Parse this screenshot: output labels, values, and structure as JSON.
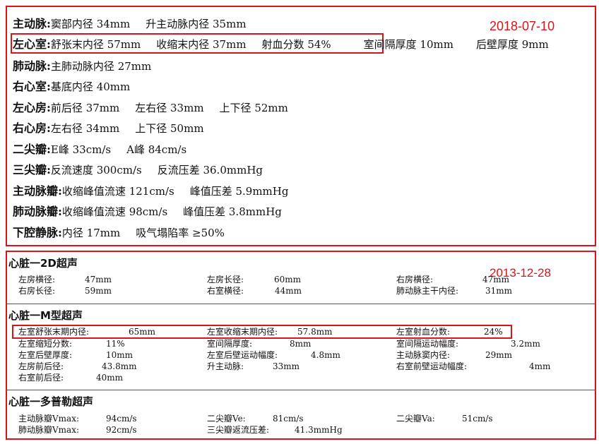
{
  "dates": {
    "recent": "2018-07-10",
    "older": "2013-12-28"
  },
  "report2018": [
    {
      "label": "主动脉:",
      "items": [
        "窦部内径 34mm",
        "升主动脉内径 35mm"
      ]
    },
    {
      "label": "左心室:",
      "items": [
        "舒张末内径 57mm",
        "收缩末内径 37mm",
        "射血分数 54%",
        "室间隔厚度 10mm",
        "后壁厚度 9mm"
      ]
    },
    {
      "label": "肺动脉:",
      "items": [
        "主肺动脉内径 27mm"
      ]
    },
    {
      "label": "右心室:",
      "items": [
        "基底内径 40mm"
      ]
    },
    {
      "label": "左心房:",
      "items": [
        "前后径 37mm",
        "左右径 33mm",
        "上下径 52mm"
      ]
    },
    {
      "label": "右心房:",
      "items": [
        "左右径 34mm",
        "上下径 50mm"
      ]
    },
    {
      "label": "二尖瓣:",
      "items": [
        "E峰 33cm/s",
        "A峰 84cm/s"
      ]
    },
    {
      "label": "三尖瓣:",
      "items": [
        "反流速度 300cm/s",
        "反流压差 36.0mmHg"
      ]
    },
    {
      "label": "主动脉瓣:",
      "items": [
        "收缩峰值流速 121cm/s",
        "峰值压差 5.9mmHg"
      ]
    },
    {
      "label": "肺动脉瓣:",
      "items": [
        "收缩峰值流速 98cm/s",
        "峰值压差 3.8mmHg"
      ]
    },
    {
      "label": "下腔静脉:",
      "items": [
        "内径 17mm",
        "吸气塌陷率 ≥50%"
      ]
    }
  ],
  "sections2013": {
    "s2d": {
      "title": "心脏一2D超声",
      "cells": [
        {
          "k": "左房横径:",
          "v": "47mm"
        },
        {
          "k": "左房长径:",
          "v": "60mm"
        },
        {
          "k": "右房横径:",
          "v": "47mm"
        },
        {
          "k": "右房长径:",
          "v": "59mm"
        },
        {
          "k": "右室横径:",
          "v": "44mm"
        },
        {
          "k": "肺动脉主干内径:",
          "v": "31mm"
        }
      ]
    },
    "sm": {
      "title": "心脏一M型超声",
      "cells": [
        {
          "k": "左室舒张末期内径:",
          "v": "65mm"
        },
        {
          "k": "左室收缩末期内径:",
          "v": "57.8mm"
        },
        {
          "k": "左室射血分数:",
          "v": "24%"
        },
        {
          "k": "左室缩短分数:",
          "v": "11%"
        },
        {
          "k": "室间隔厚度:",
          "v": "8mm"
        },
        {
          "k": "室间隔运动幅度:",
          "v": "3.2mm"
        },
        {
          "k": "左室后壁厚度:",
          "v": "10mm"
        },
        {
          "k": "左室后壁运动幅度:",
          "v": "4.8mm"
        },
        {
          "k": "主动脉窦内径:",
          "v": "29mm"
        },
        {
          "k": "左房前后径:",
          "v": "43.8mm"
        },
        {
          "k": "升主动脉:",
          "v": "33mm"
        },
        {
          "k": "右室前壁运动幅度:",
          "v": "4mm"
        },
        {
          "k": "右室前后径:",
          "v": "40mm"
        }
      ]
    },
    "sdop": {
      "title": "心脏一多普勒超声",
      "cells": [
        {
          "k": "主动脉瓣Vmax:",
          "v": "94cm/s"
        },
        {
          "k": "二尖瓣Ve:",
          "v": "81cm/s"
        },
        {
          "k": "二尖瓣Va:",
          "v": "51cm/s"
        },
        {
          "k": "肺动脉瓣Vmax:",
          "v": "92cm/s"
        },
        {
          "k": "三尖瓣返流压差:",
          "v": "41.3mmHg"
        }
      ]
    }
  }
}
